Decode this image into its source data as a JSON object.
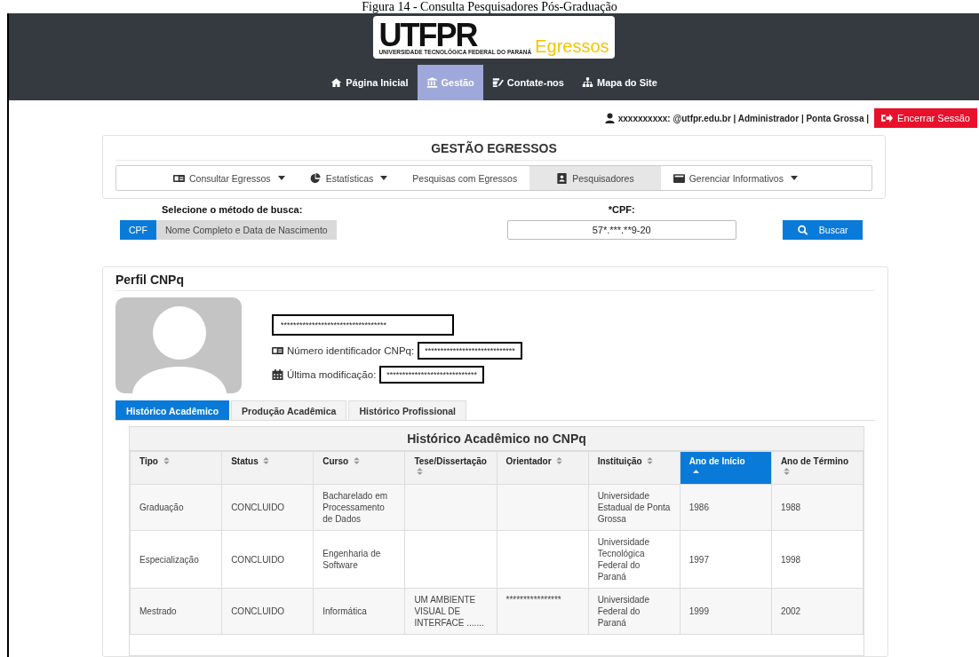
{
  "caption": "Figura 14 - Consulta Pesquisadores Pós-Graduação",
  "logo": {
    "wordmark": "UTFPR",
    "subtitle": "UNIVERSIDADE TECNOLÓGICA FEDERAL DO PARANÁ",
    "product": "Egressos"
  },
  "nav": [
    {
      "label": "Página Inicial",
      "selected": false
    },
    {
      "label": "Gestão",
      "selected": true
    },
    {
      "label": "Contate-nos",
      "selected": false
    },
    {
      "label": "Mapa do Site",
      "selected": false
    }
  ],
  "user": {
    "info": "xxxxxxxxxx: @utfpr.edu.br | Administrador | Ponta Grossa |",
    "logout": "Encerrar Sessão"
  },
  "panel": {
    "title": "GESTÃO EGRESSOS",
    "menu": [
      {
        "label": "Consultar Egressos",
        "dropdown": true,
        "selected": false
      },
      {
        "label": "Estatísticas",
        "dropdown": true,
        "selected": false
      },
      {
        "label": "Pesquisas com Egressos",
        "dropdown": false,
        "selected": false
      },
      {
        "label": "Pesquisadores",
        "dropdown": false,
        "selected": true
      },
      {
        "label": "Gerenciar Informativos",
        "dropdown": true,
        "selected": false
      }
    ]
  },
  "search": {
    "method_label": "Selecione o método de busca:",
    "methods": [
      {
        "label": "CPF",
        "selected": true
      },
      {
        "label": "Nome Completo e Data de Nascimento",
        "selected": false
      }
    ],
    "field_label": "*CPF:",
    "value": "57*.***.**9-20",
    "button": "Buscar"
  },
  "profile": {
    "title": "Perfil CNPq",
    "name": "**********************************",
    "fields": [
      {
        "label": "Número identificador CNPq:",
        "value": "*****************************"
      },
      {
        "label": "Última modificação:",
        "value": "*****************************"
      }
    ],
    "tabs": [
      {
        "label": "Histórico Acadêmico",
        "selected": true
      },
      {
        "label": "Produção Acadêmica",
        "selected": false
      },
      {
        "label": "Histórico Profissional",
        "selected": false
      }
    ]
  },
  "table": {
    "title": "Histórico Acadêmico no CNPq",
    "columns": [
      {
        "label": "Tipo",
        "sorted": false
      },
      {
        "label": "Status",
        "sorted": false
      },
      {
        "label": "Curso",
        "sorted": false
      },
      {
        "label": "Tese/Dissertação",
        "sorted": false
      },
      {
        "label": "Orientador",
        "sorted": false
      },
      {
        "label": "Instituição",
        "sorted": false
      },
      {
        "label": "Ano de Início",
        "sorted": true
      },
      {
        "label": "Ano de Término",
        "sorted": false
      }
    ],
    "rows": [
      [
        "Graduação",
        "CONCLUIDO",
        "Bacharelado em Processamento de Dados",
        "",
        "",
        "Universidade Estadual de Ponta Grossa",
        "1986",
        "1988"
      ],
      [
        "Especialização",
        "CONCLUIDO",
        "Engenharia de Software",
        "",
        "",
        "Universidade Tecnológica Federal do Paraná",
        "1997",
        "1998"
      ],
      [
        "Mestrado",
        "CONCLUIDO",
        "Informática",
        "UM AMBIENTE VISUAL DE INTERFACE .......",
        "****************",
        "Universidade Federal do Paraná",
        "1999",
        "2002"
      ]
    ]
  }
}
